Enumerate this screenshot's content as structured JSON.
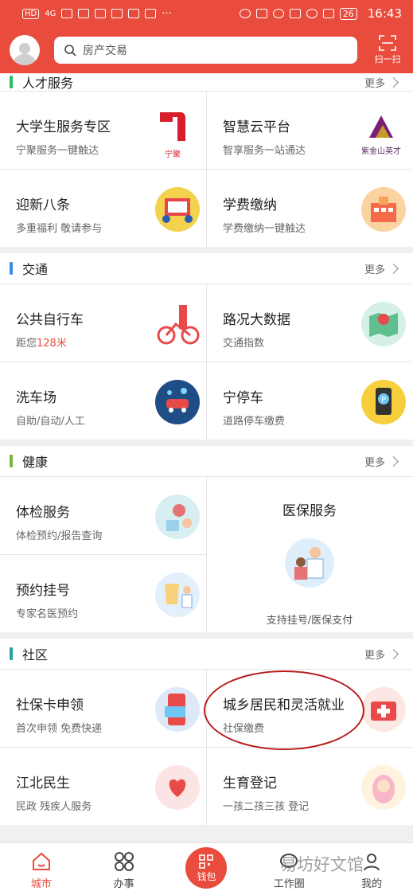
{
  "status_bar": {
    "left_badges": [
      "HD",
      "4G"
    ],
    "battery": "26",
    "time": "16:43"
  },
  "header": {
    "search_placeholder": "房产交易",
    "scan_label": "扫一扫"
  },
  "sections": {
    "talent": {
      "title": "人才服务",
      "more": "更多",
      "accent": "#2bbf6a",
      "items": [
        {
          "title": "大学生服务专区",
          "subtitle": "宁聚服务一键触达",
          "icon": "ningju-logo-icon"
        },
        {
          "title": "智慧云平台",
          "subtitle": "智享服务一站通达",
          "icon": "purple-mountain-logo-icon"
        },
        {
          "title": "迎新八条",
          "subtitle": "多重福利 敬请参与",
          "icon": "welcome-poster-icon"
        },
        {
          "title": "学费缴纳",
          "subtitle": "学费缴纳一键触达",
          "icon": "school-building-icon"
        }
      ],
      "logo_text_1": "宁聚",
      "logo_text_2": "紫金山英才"
    },
    "traffic": {
      "title": "交通",
      "more": "更多",
      "accent": "#3a8ee6",
      "items": [
        {
          "title": "公共自行车",
          "subtitle_prefix": "距您",
          "subtitle_highlight": "128米",
          "icon": "bicycle-icon"
        },
        {
          "title": "路况大数据",
          "subtitle": "交通指数",
          "icon": "map-pin-icon"
        },
        {
          "title": "洗车场",
          "subtitle": "自助/自动/人工",
          "icon": "car-wash-icon"
        },
        {
          "title": "宁停车",
          "subtitle": "道路停车缴费",
          "icon": "parking-icon"
        }
      ]
    },
    "health": {
      "title": "健康",
      "more": "更多",
      "accent": "#7cb342",
      "items": [
        {
          "title": "体检服务",
          "subtitle": "体检预约/报告查询",
          "icon": "checkup-icon"
        },
        {
          "title": "预约挂号",
          "subtitle": "专家名医预约",
          "icon": "registration-icon"
        }
      ],
      "big": {
        "title": "医保服务",
        "subtitle": "支持挂号/医保支付",
        "icon": "doctor-icon"
      }
    },
    "community": {
      "title": "社区",
      "more": "更多",
      "accent": "#26a69a",
      "items": [
        {
          "title": "社保卡申领",
          "subtitle": "首次申领 免费快递",
          "icon": "phone-card-icon"
        },
        {
          "title": "城乡居民和灵活就业",
          "subtitle": "社保缴费",
          "icon": "medical-kit-icon"
        },
        {
          "title": "江北民生",
          "subtitle": "民政 残疾人服务",
          "icon": "heart-hands-icon"
        },
        {
          "title": "生育登记",
          "subtitle": "一孩二孩三孩 登记",
          "icon": "baby-icon"
        }
      ]
    }
  },
  "nav": {
    "city": "城市",
    "affairs": "办事",
    "wallet": "钱包",
    "work": "工作圈",
    "mine": "我的"
  },
  "watermark": "易坊好文馆"
}
